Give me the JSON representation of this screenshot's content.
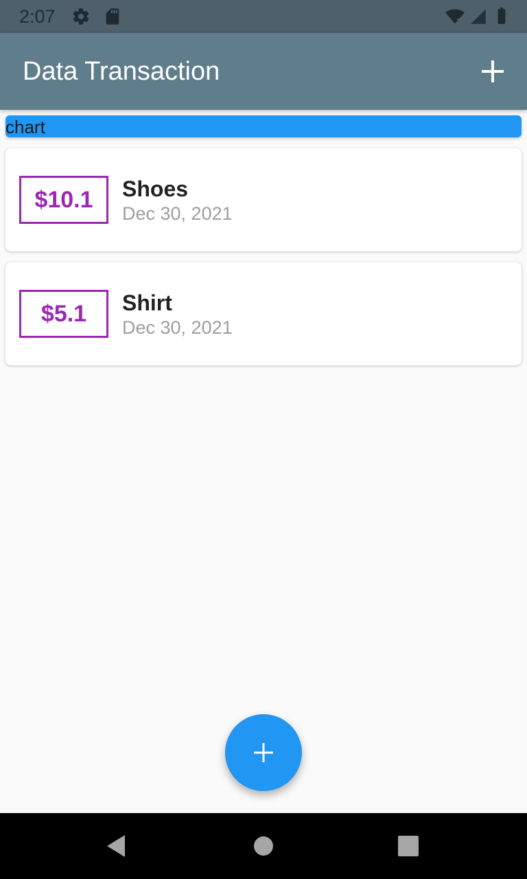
{
  "status_bar": {
    "time": "2:07",
    "icons": [
      "settings-icon",
      "sd-card-icon",
      "wifi-icon",
      "signal-icon",
      "battery-icon"
    ]
  },
  "app_bar": {
    "title": "Data Transaction",
    "action_icon": "add-icon"
  },
  "chart": {
    "label": "chart",
    "color": "#2196f3"
  },
  "transactions": [
    {
      "amount": "$10.1",
      "title": "Shoes",
      "date": "Dec 30, 2021"
    },
    {
      "amount": "$5.1",
      "title": "Shirt",
      "date": "Dec 30, 2021"
    }
  ],
  "fab": {
    "icon": "add-icon",
    "color": "#2196f3"
  },
  "nav_bar": {
    "buttons": [
      "back-icon",
      "home-icon",
      "recents-icon"
    ]
  },
  "colors": {
    "app_bar": "#607d8b",
    "status_bar": "#4d606b",
    "amount_accent": "#9c27b0",
    "date_text": "#9e9e9e"
  }
}
